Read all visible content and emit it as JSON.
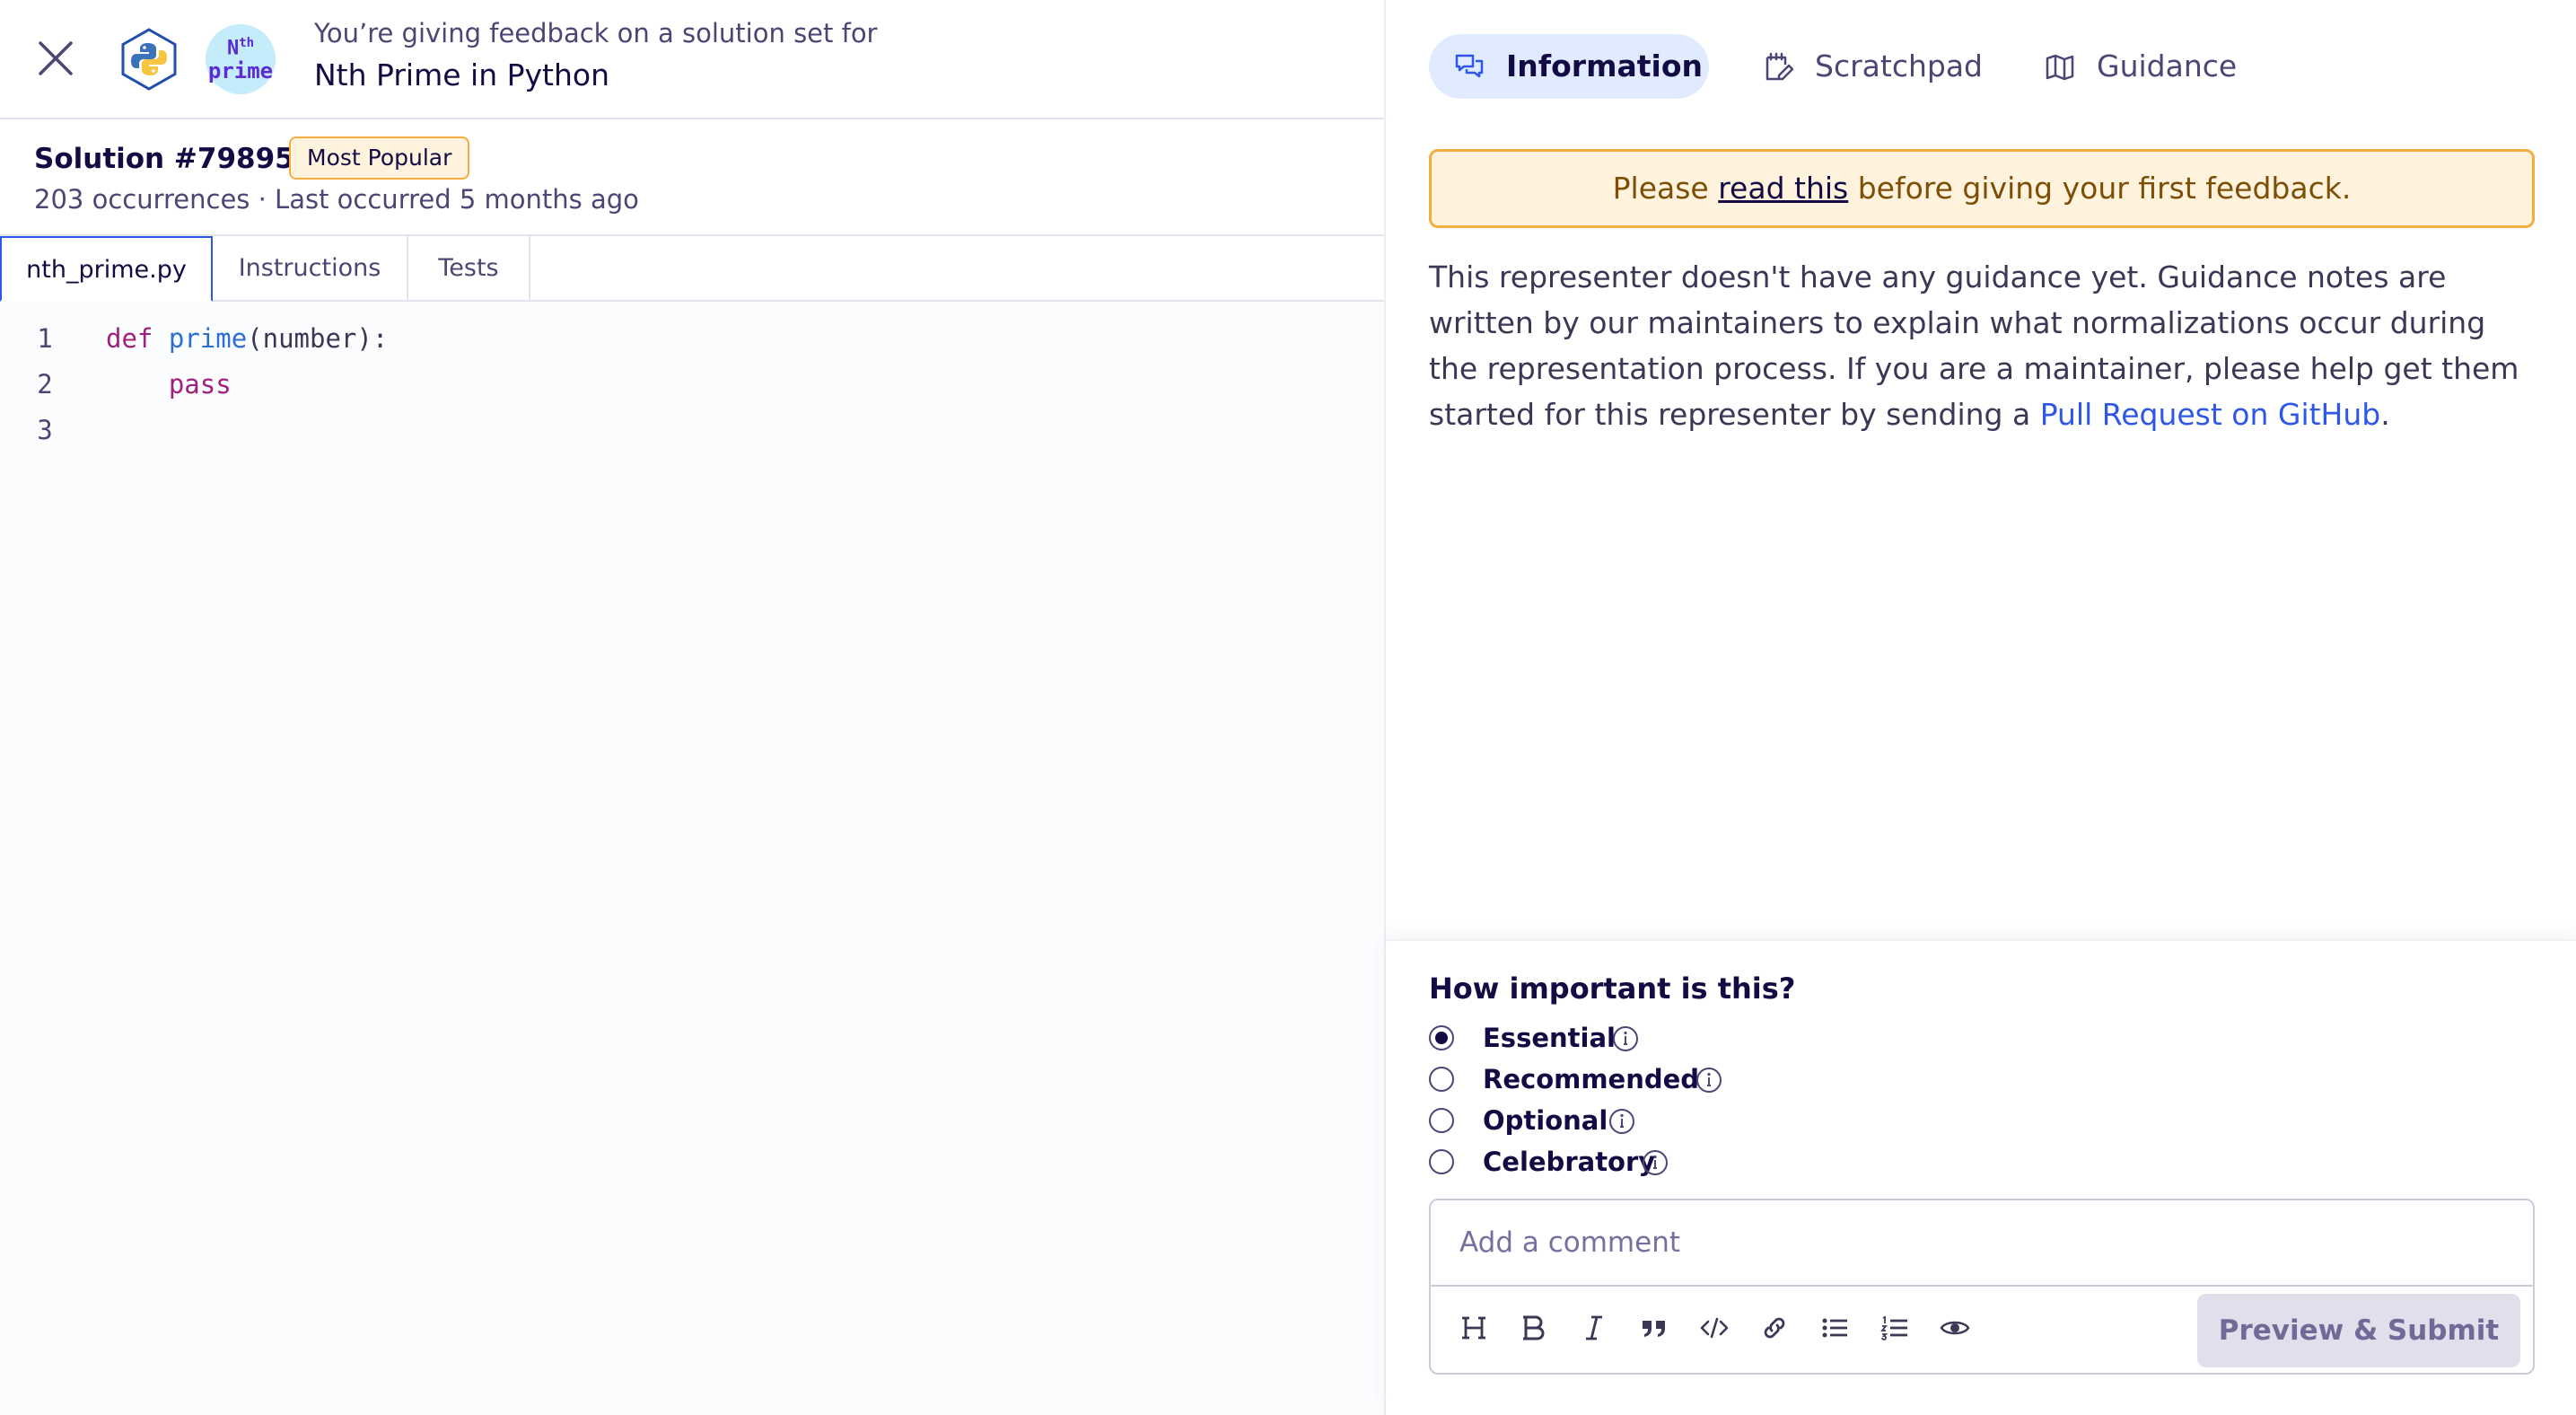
{
  "header": {
    "close_icon": "close-icon",
    "track_icon": "python-logo-icon",
    "exercise_icon_line1": "N",
    "exercise_icon_sup": "th",
    "exercise_icon_line2": "prime",
    "giving_text": "You’re giving feedback on a solution set for",
    "exercise_title": "Nth Prime in Python"
  },
  "solution": {
    "title": "Solution #798952",
    "badge": "Most Popular",
    "meta": "203 occurrences · Last occurred 5 months ago"
  },
  "file_tabs": [
    {
      "label": "nth_prime.py",
      "active": true
    },
    {
      "label": "Instructions",
      "active": false
    },
    {
      "label": "Tests",
      "active": false
    }
  ],
  "code": {
    "lines": [
      {
        "num": "1",
        "kw": "def",
        "fn": "prime",
        "rest": "(number):"
      },
      {
        "num": "2",
        "kw": "pass"
      },
      {
        "num": "3"
      }
    ]
  },
  "right_tabs": [
    {
      "label": "Information",
      "icon": "chat-bubbles-icon",
      "active": true
    },
    {
      "label": "Scratchpad",
      "icon": "notepad-pencil-icon",
      "active": false
    },
    {
      "label": "Guidance",
      "icon": "open-book-icon",
      "active": false
    }
  ],
  "notice": {
    "before": "Please ",
    "link": "read this",
    "after": " before giving your first feedback."
  },
  "guidance": {
    "text": "This representer doesn't have any guidance yet. Guidance notes are written by our maintainers to explain what normalizations occur during the representation process. If you are a maintainer, please help get them started for this representer by sending a ",
    "link": "Pull Request on GitHub",
    "end": "."
  },
  "feedback": {
    "question": "How important is this?",
    "options": [
      {
        "label": "Essential",
        "selected": true
      },
      {
        "label": "Recommended",
        "selected": false
      },
      {
        "label": "Optional",
        "selected": false
      },
      {
        "label": "Celebratory",
        "selected": false
      }
    ],
    "comment_placeholder": "Add a comment",
    "toolbar": [
      "heading-icon",
      "bold-icon",
      "italic-icon",
      "quote-icon",
      "code-icon",
      "link-icon",
      "bullet-list-icon",
      "numbered-list-icon",
      "preview-eye-icon"
    ],
    "submit_label": "Preview & Submit"
  },
  "colors": {
    "accent_blue": "#2e57e8",
    "active_tab_bg": "#e1ebff",
    "notice_border": "#f3ae3f",
    "notice_bg": "#fff3de",
    "text_primary": "#130b43",
    "keyword": "#a1207e",
    "function_name": "#2b6fd6"
  }
}
